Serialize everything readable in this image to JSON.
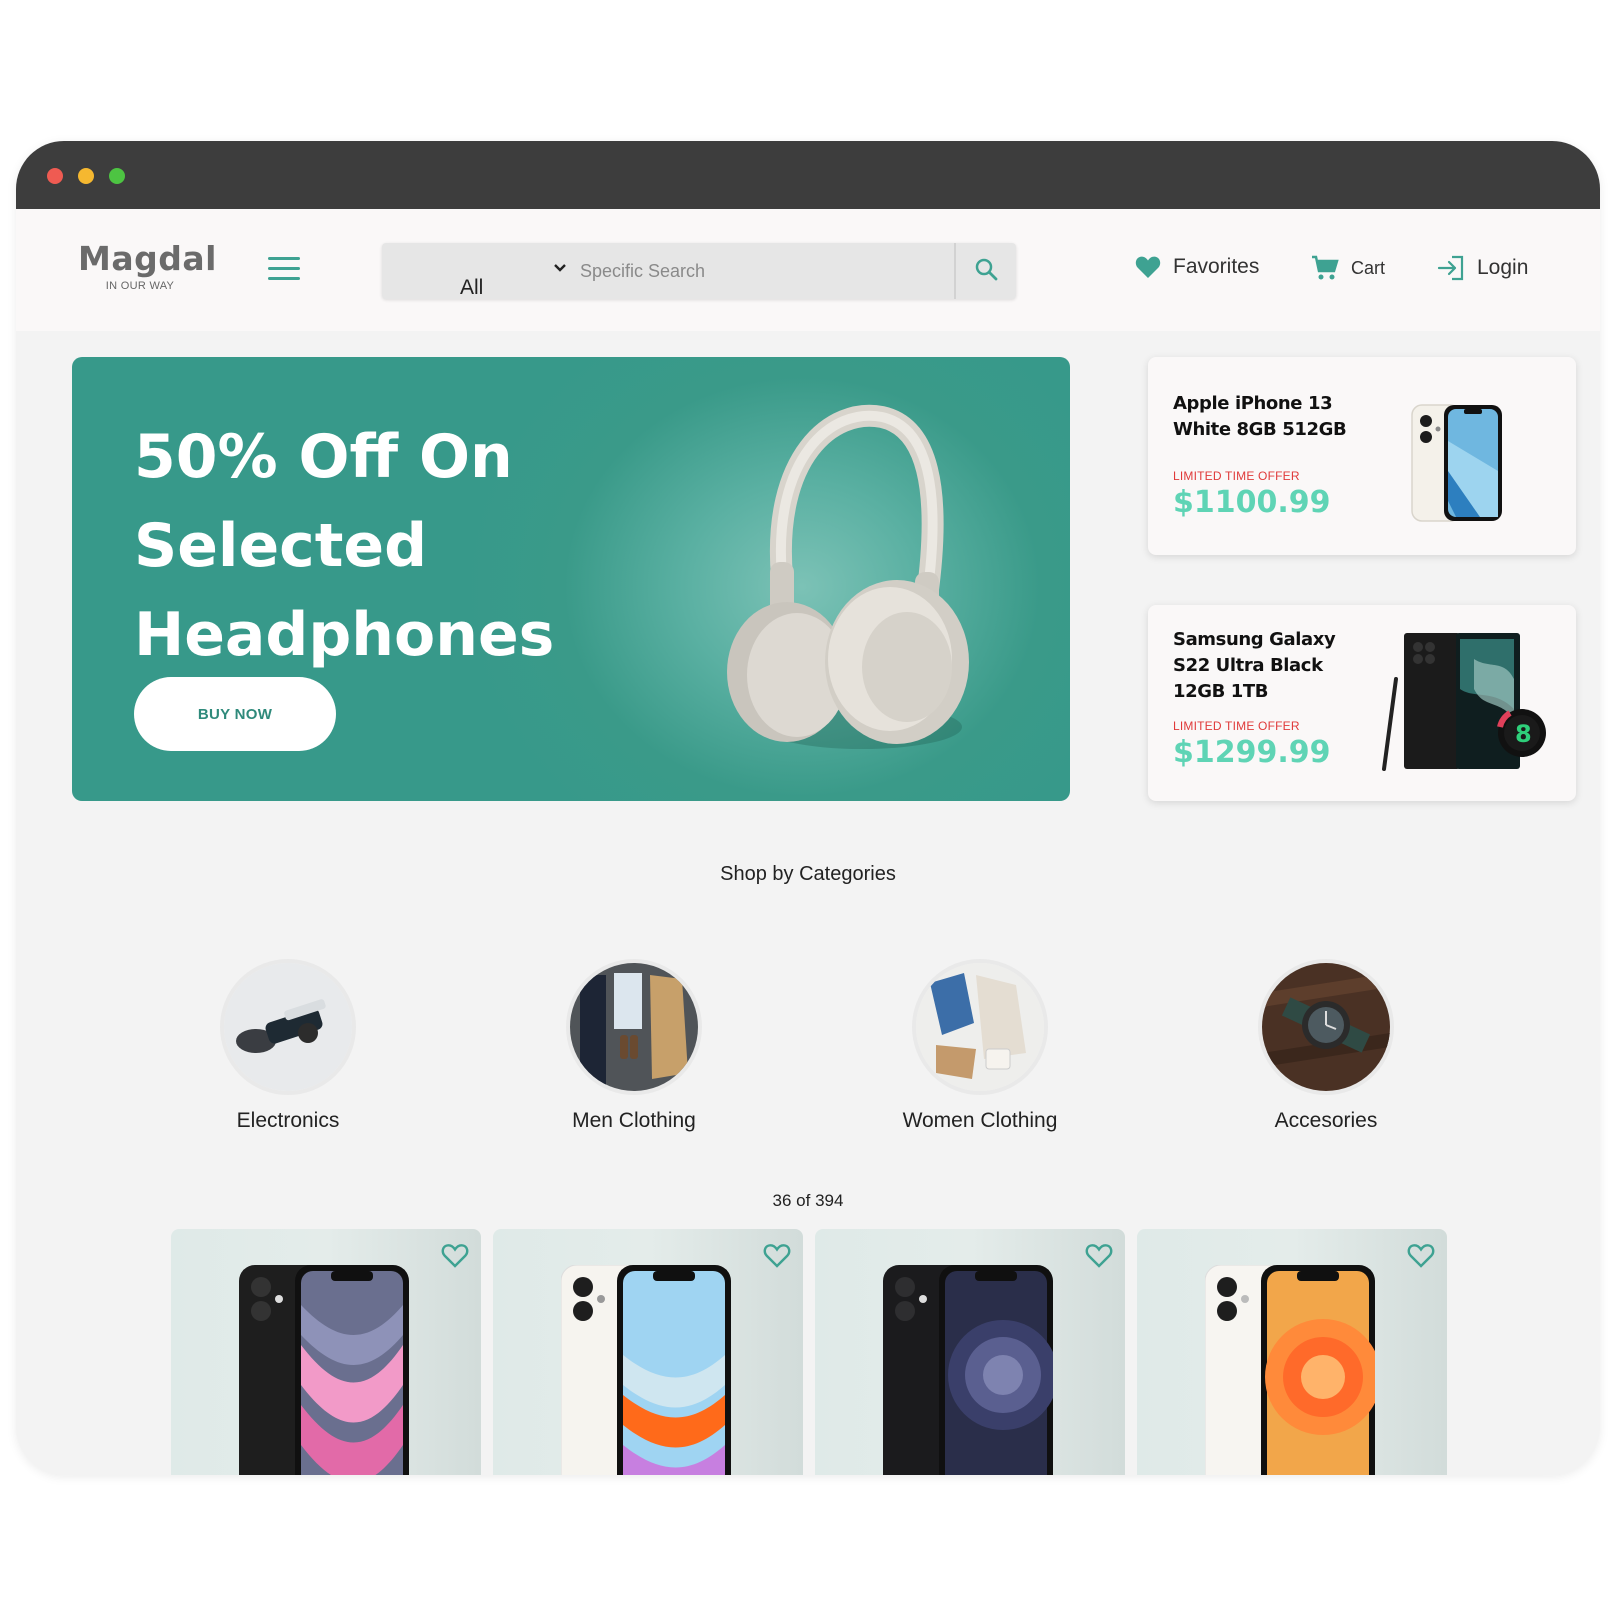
{
  "brand": {
    "name": "Magdal",
    "tagline": "IN OUR WAY"
  },
  "search": {
    "category": "All",
    "placeholder": "Specific Search"
  },
  "nav": {
    "favorites": "Favorites",
    "cart": "Cart",
    "login": "Login"
  },
  "hero": {
    "line1": "50% Off On",
    "line2": "Selected",
    "line3": "Headphones",
    "cta": "BUY NOW"
  },
  "promos": [
    {
      "name": "Apple iPhone 13 White 8GB 512GB",
      "offer": "LIMITED TIME OFFER",
      "price": "$1100.99"
    },
    {
      "name": "Samsung Galaxy S22 Ultra Black 12GB 1TB",
      "offer": "LIMITED TIME OFFER",
      "price": "$1299.99"
    }
  ],
  "categories": {
    "title": "Shop by Categories",
    "items": [
      {
        "label": "Electronics"
      },
      {
        "label": "Men Clothing"
      },
      {
        "label": "Women Clothing"
      },
      {
        "label": "Accesories"
      }
    ]
  },
  "products": {
    "count": "36 of 394"
  },
  "colors": {
    "accent": "#3ea292",
    "price": "#5fd4b5",
    "offer": "#e03a3a",
    "titlebar": "#3d3d3d"
  }
}
